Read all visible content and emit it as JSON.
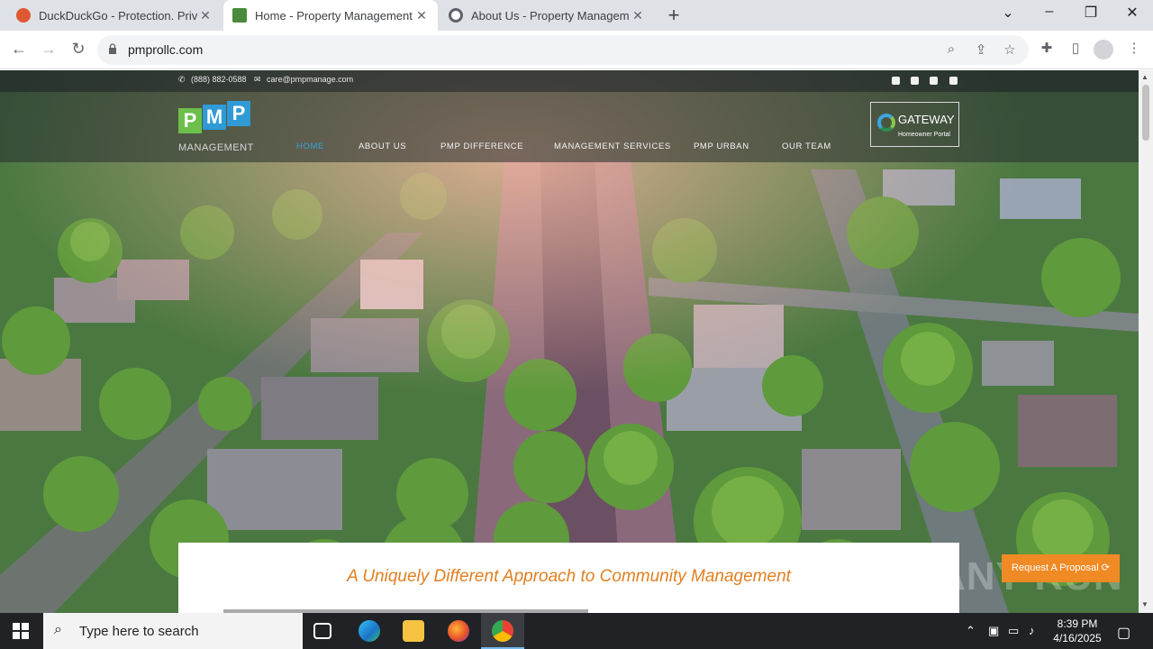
{
  "browser": {
    "tabs": [
      {
        "title": "DuckDuckGo - Protection. Privac",
        "active": false,
        "favicon_color": "#de5833"
      },
      {
        "title": "Home - Property Management F",
        "active": true,
        "favicon_color": "#4a8a3c"
      },
      {
        "title": "About Us - Property Manageme",
        "active": false,
        "favicon_color": "#5f6368"
      }
    ],
    "new_tab_label": "+",
    "url": "pmprollc.com"
  },
  "site": {
    "phone": "(888) 882-0588",
    "email": "care@pmpmanage.com",
    "logo": {
      "letters": [
        "P",
        "M",
        "P"
      ],
      "subtitle": "MANAGEMENT",
      "colors": [
        "#6cbf4a",
        "#2f9ad6",
        "#2f9ad6"
      ]
    },
    "nav": [
      "HOME",
      "ABOUT US",
      "PMP DIFFERENCE",
      "MANAGEMENT SERVICES",
      "PMP URBAN",
      "OUR TEAM"
    ],
    "active_nav": "HOME",
    "gateway": {
      "title": "GATEWAY",
      "subtitle": "Homeowner Portal"
    },
    "tagline": "A Uniquely Different Approach to Community Management",
    "cta": "Request A Proposal ⟳",
    "accent_color": "#e07f20",
    "cta_color": "#f08a24"
  },
  "watermark": "ANY RUN",
  "taskbar": {
    "search_placeholder": "Type here to search",
    "time": "8:39 PM",
    "date": "4/16/2025"
  }
}
